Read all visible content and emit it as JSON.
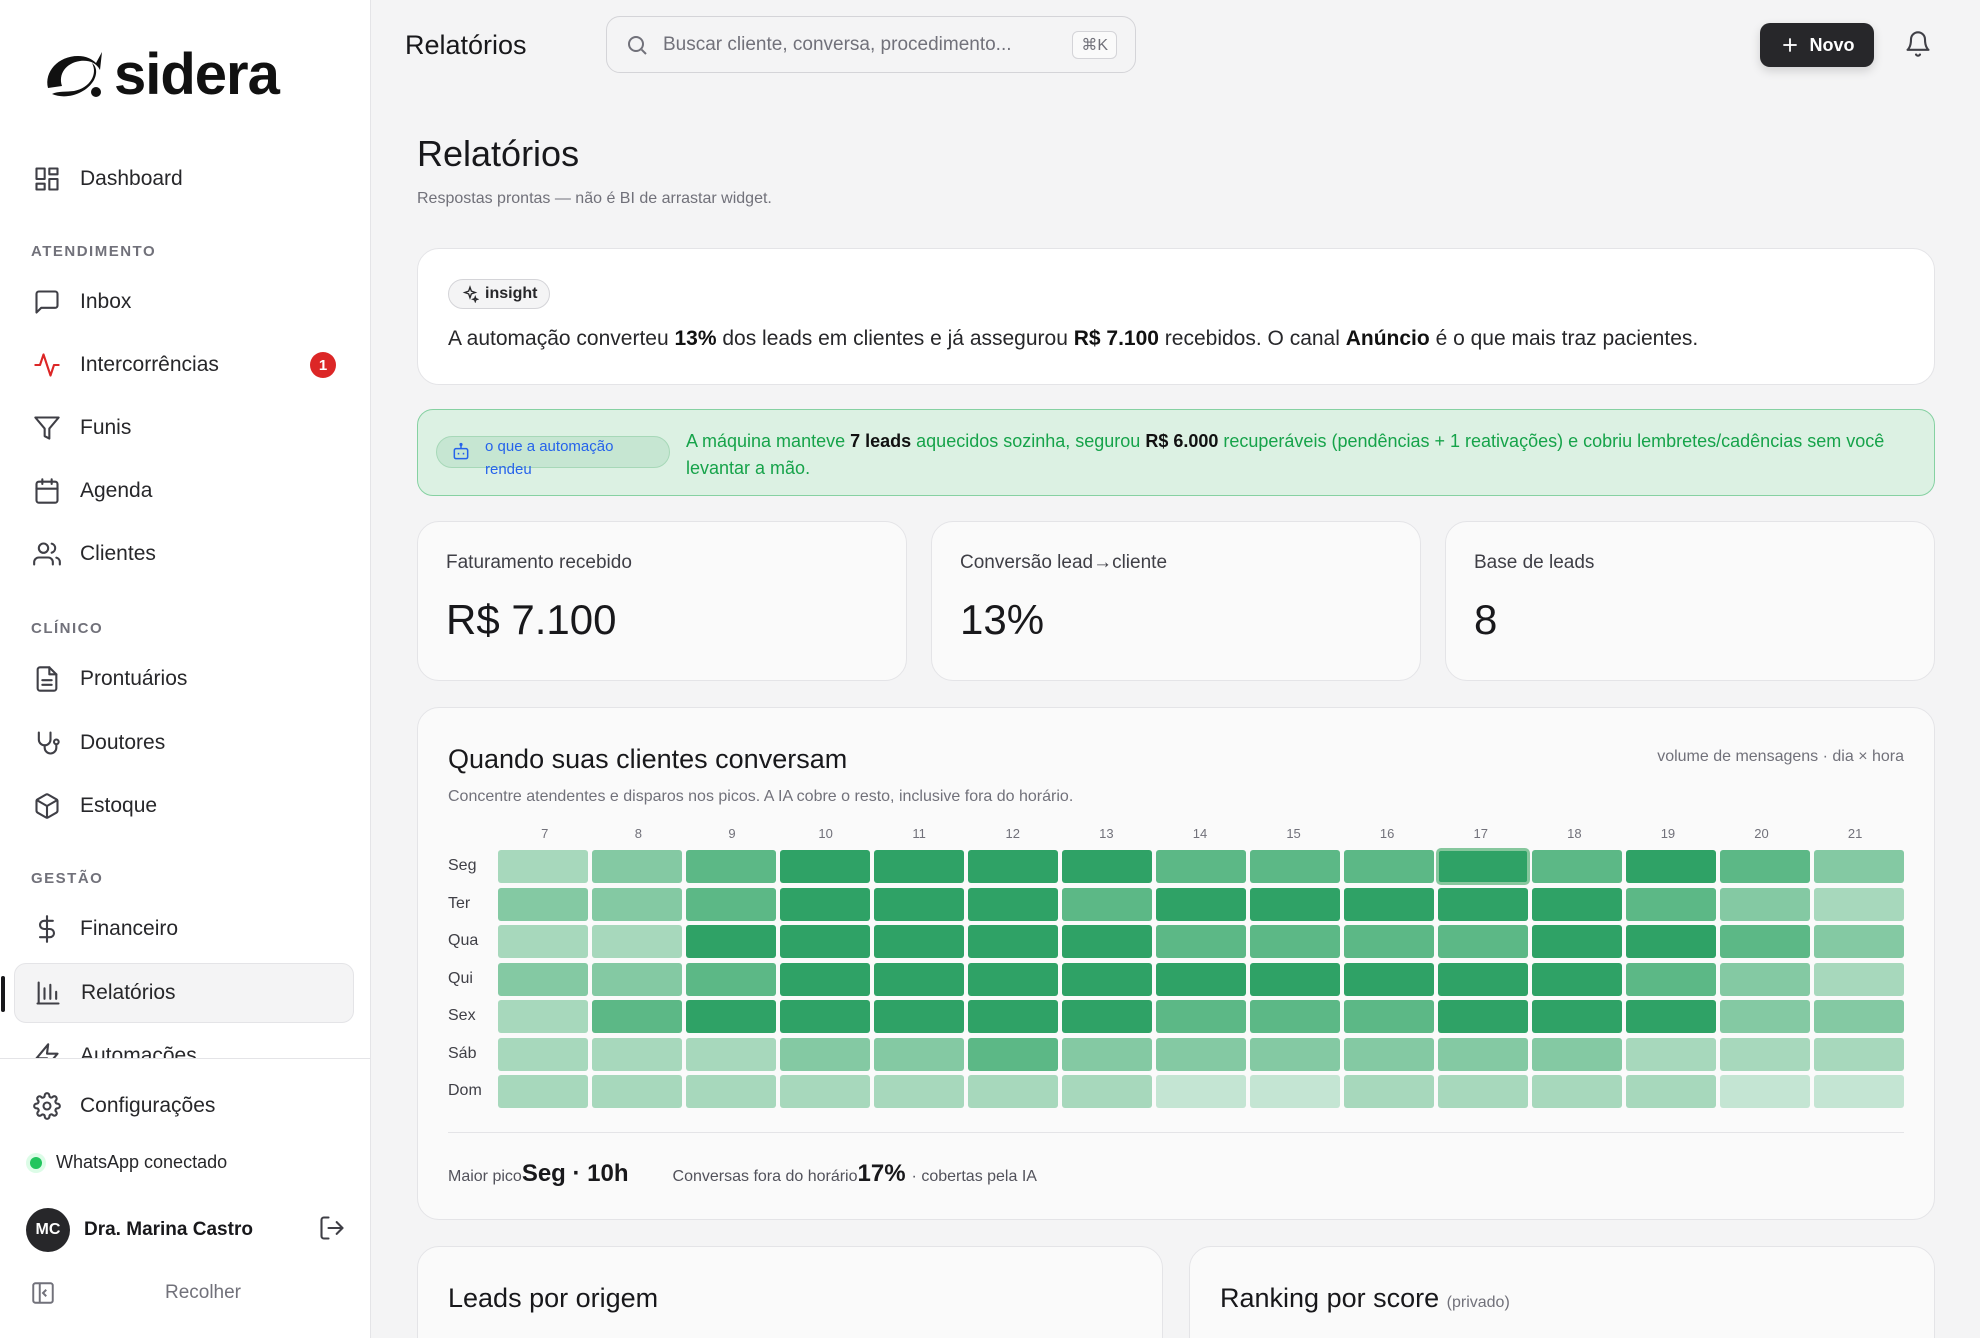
{
  "brand": {
    "name": "sidera"
  },
  "sidebar": {
    "dashboard": "Dashboard",
    "sections": {
      "atendimento": "ATENDIMENTO",
      "clinico": "CLÍNICO",
      "gestao": "GESTÃO"
    },
    "items": {
      "inbox": "Inbox",
      "intercorrencias": "Intercorrências",
      "intercorrencias_badge": "1",
      "funis": "Funis",
      "agenda": "Agenda",
      "clientes": "Clientes",
      "prontuarios": "Prontuários",
      "doutores": "Doutores",
      "estoque": "Estoque",
      "financeiro": "Financeiro",
      "relatorios": "Relatórios",
      "automacoes": "Automações",
      "configuracoes": "Configurações"
    },
    "whatsapp_status": "WhatsApp conectado",
    "user": {
      "initials": "MC",
      "name": "Dra. Marina Castro"
    },
    "collapse_label": "Recolher"
  },
  "topbar": {
    "title": "Relatórios",
    "search_placeholder": "Buscar cliente, conversa, procedimento...",
    "search_shortcut": "⌘K",
    "new_button": "Novo"
  },
  "page": {
    "title": "Relatórios",
    "subtitle": "Respostas prontas — não é BI de arrastar widget."
  },
  "insight": {
    "chip": "insight",
    "t1": "A automação converteu ",
    "b1": "13%",
    "t2": " dos leads em clientes e já assegurou ",
    "b2": "R$ 7.100",
    "t3": " recebidos. O canal ",
    "b3": "Anúncio",
    "t4": " é o que mais traz pacientes."
  },
  "automation": {
    "chip": "o que a automação rendeu",
    "t1": "A máquina manteve ",
    "b1": "7 leads",
    "t2": " aquecidos sozinha, segurou ",
    "b2": "R$ 6.000",
    "t3": " recuperáveis (pendências + 1 reativações) e cobriu lembretes/cadências sem você levantar a mão."
  },
  "kpis": [
    {
      "label": "Faturamento recebido",
      "value": "R$ 7.100"
    },
    {
      "label": "Conversão lead→cliente",
      "value": "13%"
    },
    {
      "label": "Base de leads",
      "value": "8"
    }
  ],
  "heatmap": {
    "title": "Quando suas clientes conversam",
    "meta": "volume de mensagens · dia × hora",
    "subtitle": "Concentre atendentes e disparos nos picos. A IA cobre o resto, inclusive fora do horário.",
    "hours": [
      "7",
      "8",
      "9",
      "10",
      "11",
      "12",
      "13",
      "14",
      "15",
      "16",
      "17",
      "18",
      "19",
      "20",
      "21"
    ],
    "days": [
      "Seg",
      "Ter",
      "Qua",
      "Qui",
      "Sex",
      "Sáb",
      "Dom"
    ],
    "levels": [
      [
        2,
        3,
        4,
        5,
        5,
        5,
        5,
        4,
        4,
        4,
        5,
        4,
        5,
        4,
        3
      ],
      [
        3,
        3,
        4,
        5,
        5,
        5,
        4,
        5,
        5,
        5,
        5,
        5,
        4,
        3,
        2
      ],
      [
        2,
        2,
        5,
        5,
        5,
        5,
        5,
        4,
        4,
        4,
        4,
        5,
        5,
        4,
        3
      ],
      [
        3,
        3,
        4,
        5,
        5,
        5,
        5,
        5,
        5,
        5,
        5,
        5,
        4,
        3,
        2
      ],
      [
        2,
        4,
        5,
        5,
        5,
        5,
        5,
        4,
        4,
        4,
        5,
        5,
        5,
        3,
        3
      ],
      [
        2,
        2,
        2,
        3,
        3,
        4,
        3,
        3,
        3,
        3,
        3,
        3,
        2,
        2,
        2
      ],
      [
        2,
        2,
        2,
        2,
        2,
        2,
        2,
        1,
        1,
        2,
        2,
        2,
        2,
        1,
        1
      ]
    ],
    "highlight": {
      "day": "Seg",
      "hour": "17"
    },
    "colors": [
      "#e2f1e8",
      "#c4e5d3",
      "#a7d8bc",
      "#84c9a3",
      "#5cb886",
      "#2fa266"
    ],
    "peak_label": "Maior pico",
    "peak_value": "Seg · 10h",
    "offhours_label": "Conversas fora do horário",
    "offhours_value": "17%",
    "offhours_note": "· cobertas pela IA"
  },
  "bottom": {
    "leads_title": "Leads por origem",
    "ranking_title": "Ranking por score",
    "ranking_note": "(privado)"
  }
}
